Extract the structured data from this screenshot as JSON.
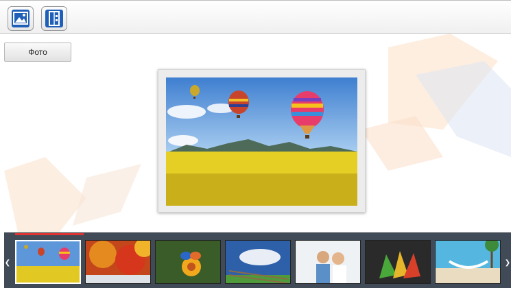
{
  "toolbar": {
    "buttons": [
      {
        "icon": "image-icon"
      },
      {
        "icon": "book-icon"
      }
    ]
  },
  "sidebar": {
    "tab_label": "Фото"
  },
  "viewer": {
    "image": "hot-air-balloons-over-yellow-field"
  },
  "filmstrip": {
    "prev_icon": "chevron-left-icon",
    "next_icon": "chevron-right-icon",
    "selected_index": 0,
    "thumbnails": [
      "hot-air-balloons",
      "autumn-trees",
      "butterfly-on-flower",
      "fence-and-clouds",
      "couple-on-beach",
      "colorful-leaves",
      "beach-hammock"
    ]
  },
  "colors": {
    "accent": "#1f5fb8",
    "strip_bg": "#414b58",
    "progress": "#dd3333"
  }
}
